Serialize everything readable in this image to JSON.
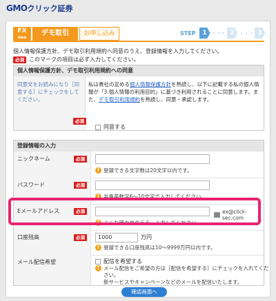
{
  "brand": {
    "logo_main": "GMO",
    "logo_rest": "クリック証券"
  },
  "tabs": {
    "fx_top": "FX",
    "fx_sub": "neo",
    "demo": "デモ取引",
    "apply": "お申し込み"
  },
  "steps": {
    "label": "STEP",
    "items": [
      "1",
      "2",
      "3"
    ],
    "current": 1
  },
  "intro": "個人情報保護方針、デモ取引利用規約へ同意のうえ、登録情報を入力してください。",
  "required_badge": "必須",
  "required_note": "このマークの項目は必ず入力してください。",
  "agreement": {
    "heading": "個人情報保護方針、デモ取引利用規約への同意",
    "left_text": "同意文をお読みになり［同意する］にチェックをしてください。",
    "text_pre": "私は貴社の定める",
    "link1": "個人情報保護方針",
    "text_mid": "を熟読し、以下に記載する私の個人情報が「3.個人情報の利用目的」に基づき利用されることに同意します。また、",
    "link2": "デモ取引利用規約",
    "text_post": "を熟読し、同意・承認します。",
    "checkbox_label": "同意する"
  },
  "registration": {
    "heading": "登録情報の入力",
    "nickname": {
      "label": "ニックネーム",
      "value": "",
      "hint": "登録できる文字数は20文字以内です。"
    },
    "password": {
      "label": "パスワード",
      "value": "",
      "hint": "半角英数字6〜10文字で入力してください。"
    },
    "email": {
      "label": "Eメールアドレス",
      "value": "",
      "hint": "よくお確かめのうえ、入力してください。",
      "example": "ex@click-sec.com"
    },
    "balance": {
      "label": "口座残高",
      "value": "1000",
      "unit": "万円",
      "hint": "登録できる口座残高は10〜9999万円以内です。"
    },
    "mail_delivery": {
      "label": "メール配信希望",
      "option": "配信を希望する",
      "hint1": "メール配信をご希望の方は［配信を希望する］にチェックを入れてください。",
      "hint2": "新サービスやキャンペーンなどのメールを配信いたします。"
    }
  },
  "confirm_button": "確認画面へ",
  "colors": {
    "orange": "#f39a1e",
    "required_red": "#d81e1e",
    "step_blue": "#5aa0d8",
    "highlight_pink": "#e8236e",
    "button_blue": "#2d7fd3"
  }
}
